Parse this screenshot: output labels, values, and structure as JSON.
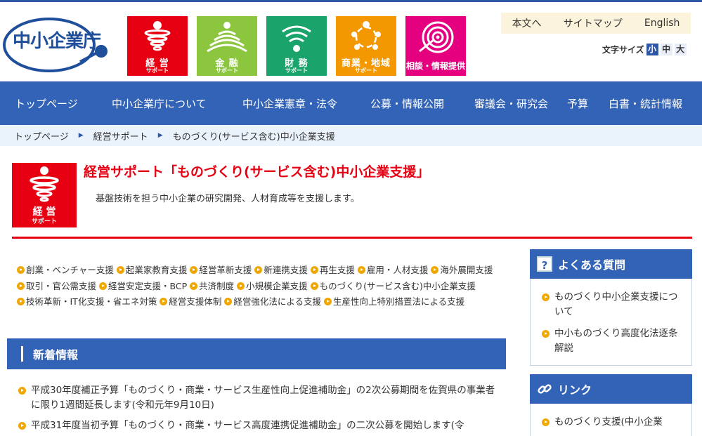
{
  "header": {
    "logo_text": "中小企業庁",
    "categories": [
      {
        "label": "経 営",
        "sub": "サポート",
        "color": "#e60012",
        "icon": "tornado-icon"
      },
      {
        "label": "金 融",
        "sub": "サポート",
        "color": "#8cc63f",
        "icon": "signal-waves-icon"
      },
      {
        "label": "財 務",
        "sub": "サポート",
        "color": "#1aa36a",
        "icon": "wifi-fan-icon"
      },
      {
        "label": "商業・地域",
        "sub": "サポート",
        "color": "#f39800",
        "icon": "cycle-arrows-icon"
      },
      {
        "label": "相談・情報提供",
        "sub": "",
        "color": "#e4007f",
        "icon": "ripple-icon"
      }
    ],
    "utility_links": [
      "本文へ",
      "サイトマップ",
      "English"
    ],
    "font_size": {
      "label": "文字サイズ",
      "options": [
        "小",
        "中",
        "大"
      ],
      "selected": "小"
    }
  },
  "nav": {
    "items": [
      "トップページ",
      "中小企業庁について",
      "中小企業憲章・法令",
      "公募・情報公開",
      "審議会・研究会",
      "予算",
      "白書・統計情報"
    ]
  },
  "breadcrumb": [
    "トップページ",
    "経営サポート",
    "ものづくり(サービス含む)中小企業支援"
  ],
  "page": {
    "icon_label": "経 営",
    "icon_sub": "サポート",
    "title": "経営サポート「ものづくり(サービス含む)中小企業支援」",
    "description": "基盤技術を担う中小企業の研究開発、人材育成等を支援します。"
  },
  "topic_links": [
    "創業・ベンチャー支援",
    "起業家教育支援",
    "経営革新支援",
    "新連携支援",
    "再生支援",
    "雇用・人材支援",
    "海外展開支援",
    "取引・官公需支援",
    "経営安定支援・BCP",
    "共済制度",
    "小規模企業支援",
    "ものづくり(サービス含む)中小企業支援",
    "技術革新・IT化支援・省エネ対策",
    "経営支援体制",
    "経営強化法による支援",
    "生産性向上特別措置法による支援"
  ],
  "news": {
    "heading": "新着情報",
    "items": [
      "平成30年度補正予算「ものづくり・商業・サービス生産性向上促進補助金」の2次公募期間を佐賀県の事業者に限り1週間延長します(令和元年9月10日)",
      "平成31年度当初予算「ものづくり・商業・サービス高度連携促進補助金」の二次公募を開始します(令"
    ]
  },
  "sidebar": {
    "faq": {
      "heading": "よくある質問",
      "items": [
        "ものづくり中小企業支援について",
        "中小ものづくり高度化法逐条解説"
      ]
    },
    "links": {
      "heading": "リンク",
      "items": [
        "ものづくり支援(中小企業"
      ]
    }
  }
}
